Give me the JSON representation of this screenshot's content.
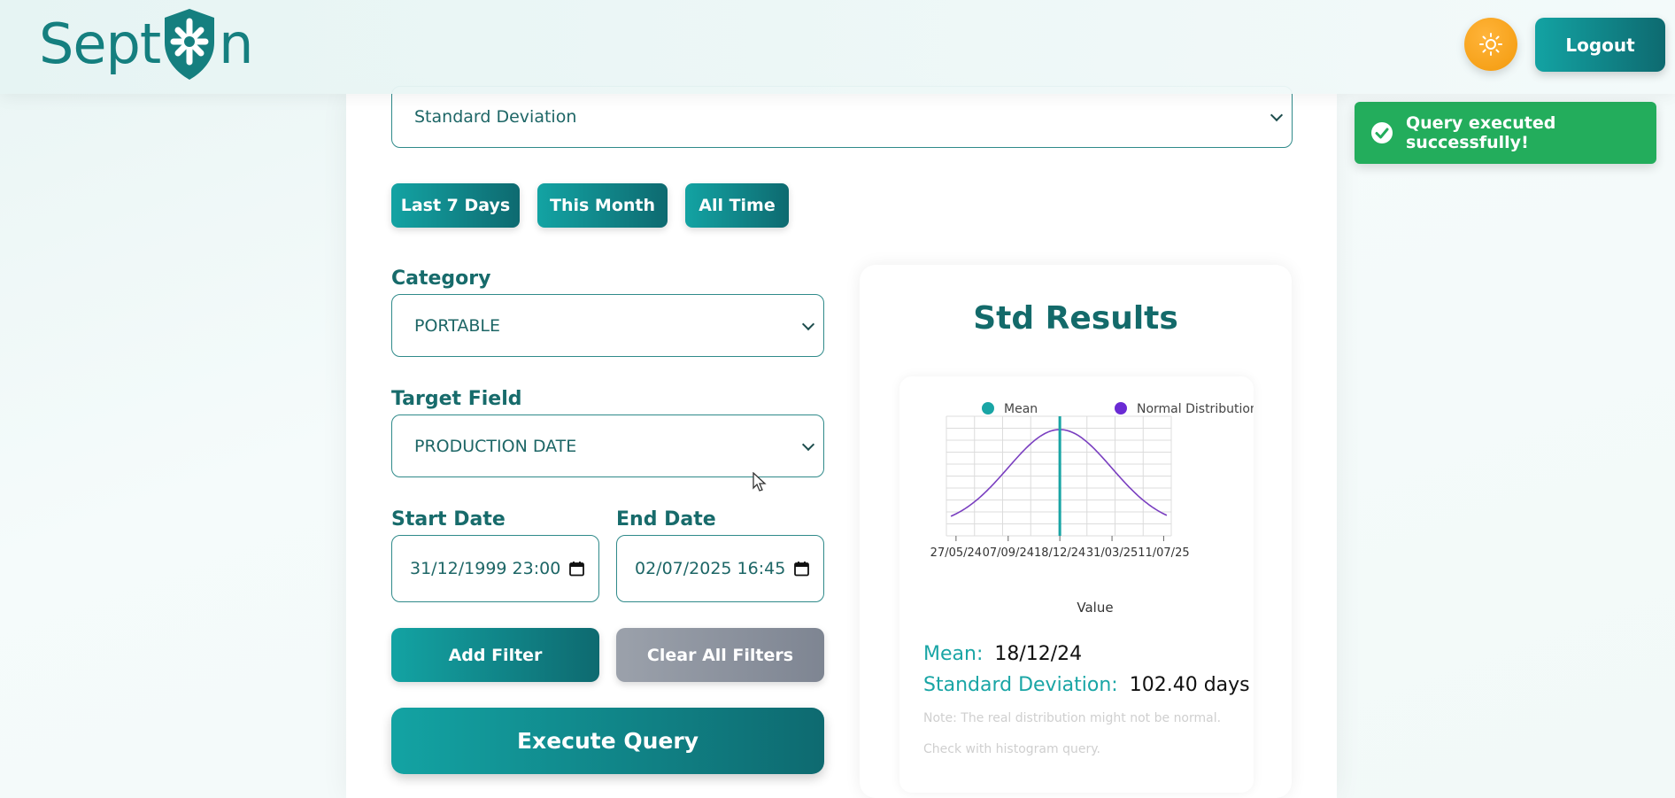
{
  "header": {
    "logo_left": "Sept",
    "logo_right": "n",
    "logout_label": "Logout"
  },
  "query": {
    "operation_value": "Standard Deviation",
    "quick_ranges": [
      "Last 7 Days",
      "This Month",
      "All Time"
    ],
    "category_label": "Category",
    "category_value": "PORTABLE",
    "target_field_label": "Target Field",
    "target_field_value": "PRODUCTION DATE",
    "start_date_label": "Start Date",
    "start_date_value": "31/12/1999 23:00",
    "end_date_label": "End Date",
    "end_date_value": "02/07/2025 16:45",
    "add_filter_label": "Add Filter",
    "clear_filters_label": "Clear All Filters",
    "execute_label": "Execute Query"
  },
  "results": {
    "title": "Std Results",
    "mean_key": "Mean:",
    "mean_value": "18/12/24",
    "std_key": "Standard Deviation:",
    "std_value": "102.40 days",
    "note_line1": "Note: The real distribution might not be normal.",
    "note_line2": "Check with histogram query."
  },
  "toast": {
    "message": "Query executed successfully!"
  },
  "colors": {
    "primary": "#13a3a3",
    "primary_dark": "#0e6a70",
    "mean_series": "#19a5a5",
    "normal_series": "#6a2bd4",
    "toast_bg": "#23ad5c",
    "theme_button": "#f39a0c",
    "clear_button": "#8e95a1"
  },
  "chart_data": {
    "type": "line",
    "xlabel": "Value",
    "ylabel": "",
    "x_ticks": [
      "27/05/24",
      "07/09/24",
      "18/12/24",
      "31/03/25",
      "11/07/25"
    ],
    "series": [
      {
        "name": "Mean",
        "type": "vertical-line",
        "x": "18/12/24"
      },
      {
        "name": "Normal Distribution",
        "type": "curve",
        "mean": "18/12/24",
        "std_days": 102.4,
        "x_range": [
          "2024-05-08",
          "2025-07-26"
        ]
      }
    ],
    "legend": "top",
    "grid": true
  }
}
